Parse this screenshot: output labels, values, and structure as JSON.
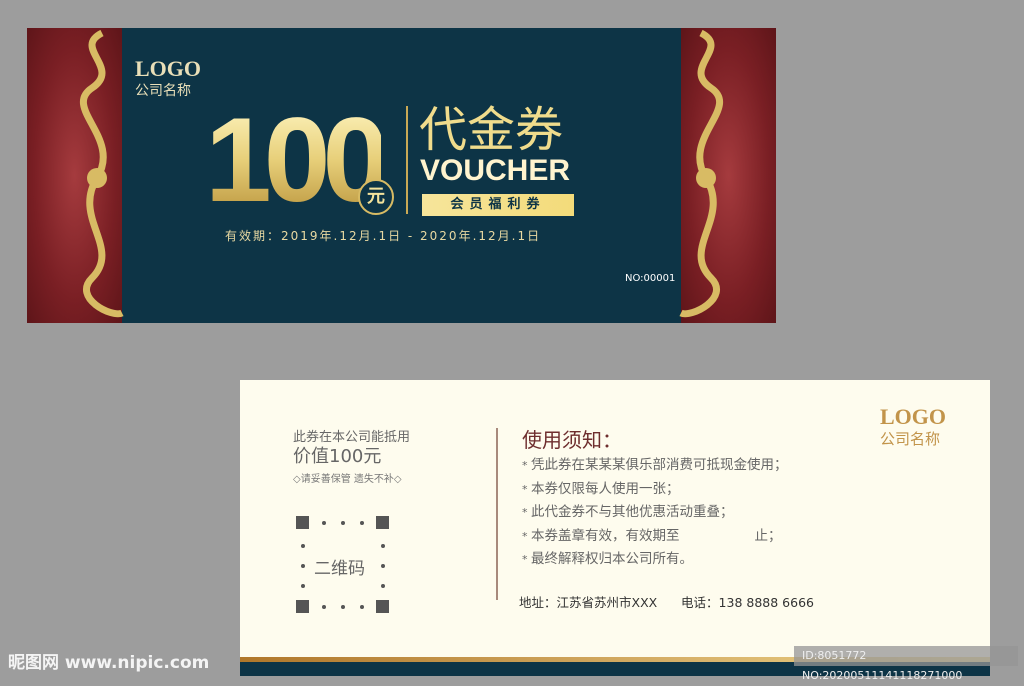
{
  "front": {
    "logo": "LOGO",
    "company": "公司名称",
    "amount": "100",
    "unit": "元",
    "title_cn": "代金券",
    "title_en": "VOUCHER",
    "badge": "会员福利券",
    "validity": "有效期：2019年.12月.1日 - 2020年.12月.1日",
    "serial": "NO:00001"
  },
  "back": {
    "line1": "此券在本公司能抵用",
    "line2": "价值100元",
    "line3": "◇请妥善保管 遗失不补◇",
    "qr_label": "二维码",
    "rules_title": "使用须知：",
    "rules": [
      "凭此券在某某某俱乐部消费可抵现金使用；",
      "本券仅限每人使用一张；",
      "此代金券不与其他优惠活动重叠；",
      "本券盖章有效，有效期至",
      "最终解释权归本公司所有。"
    ],
    "rule4_end": "止；",
    "address": "地址：江苏省苏州市XXX",
    "phone": "电话：138 8888 6666",
    "logo": "LOGO",
    "company": "公司名称"
  },
  "watermark": "昵图网 www.nipic.com",
  "image_id": "ID:8051772 NO:20200511141118271000",
  "colors": {
    "navy": "#0d3446",
    "gold": "#d8bb64",
    "burgundy": "#7a1f24",
    "cream": "#fefcee"
  }
}
